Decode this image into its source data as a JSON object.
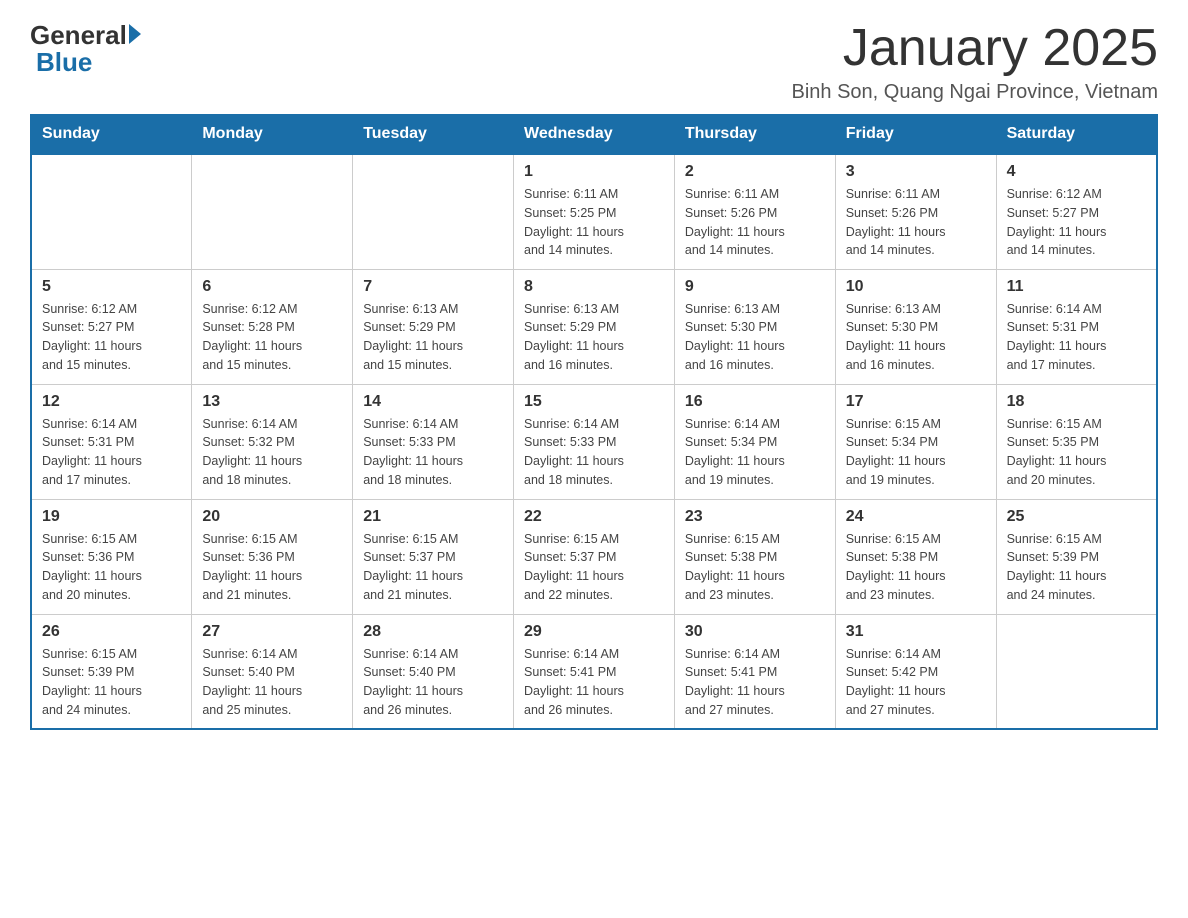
{
  "header": {
    "logo_general": "General",
    "logo_blue": "Blue",
    "month_title": "January 2025",
    "location": "Binh Son, Quang Ngai Province, Vietnam"
  },
  "days_of_week": [
    "Sunday",
    "Monday",
    "Tuesday",
    "Wednesday",
    "Thursday",
    "Friday",
    "Saturday"
  ],
  "weeks": [
    [
      {
        "day": "",
        "info": ""
      },
      {
        "day": "",
        "info": ""
      },
      {
        "day": "",
        "info": ""
      },
      {
        "day": "1",
        "info": "Sunrise: 6:11 AM\nSunset: 5:25 PM\nDaylight: 11 hours\nand 14 minutes."
      },
      {
        "day": "2",
        "info": "Sunrise: 6:11 AM\nSunset: 5:26 PM\nDaylight: 11 hours\nand 14 minutes."
      },
      {
        "day": "3",
        "info": "Sunrise: 6:11 AM\nSunset: 5:26 PM\nDaylight: 11 hours\nand 14 minutes."
      },
      {
        "day": "4",
        "info": "Sunrise: 6:12 AM\nSunset: 5:27 PM\nDaylight: 11 hours\nand 14 minutes."
      }
    ],
    [
      {
        "day": "5",
        "info": "Sunrise: 6:12 AM\nSunset: 5:27 PM\nDaylight: 11 hours\nand 15 minutes."
      },
      {
        "day": "6",
        "info": "Sunrise: 6:12 AM\nSunset: 5:28 PM\nDaylight: 11 hours\nand 15 minutes."
      },
      {
        "day": "7",
        "info": "Sunrise: 6:13 AM\nSunset: 5:29 PM\nDaylight: 11 hours\nand 15 minutes."
      },
      {
        "day": "8",
        "info": "Sunrise: 6:13 AM\nSunset: 5:29 PM\nDaylight: 11 hours\nand 16 minutes."
      },
      {
        "day": "9",
        "info": "Sunrise: 6:13 AM\nSunset: 5:30 PM\nDaylight: 11 hours\nand 16 minutes."
      },
      {
        "day": "10",
        "info": "Sunrise: 6:13 AM\nSunset: 5:30 PM\nDaylight: 11 hours\nand 16 minutes."
      },
      {
        "day": "11",
        "info": "Sunrise: 6:14 AM\nSunset: 5:31 PM\nDaylight: 11 hours\nand 17 minutes."
      }
    ],
    [
      {
        "day": "12",
        "info": "Sunrise: 6:14 AM\nSunset: 5:31 PM\nDaylight: 11 hours\nand 17 minutes."
      },
      {
        "day": "13",
        "info": "Sunrise: 6:14 AM\nSunset: 5:32 PM\nDaylight: 11 hours\nand 18 minutes."
      },
      {
        "day": "14",
        "info": "Sunrise: 6:14 AM\nSunset: 5:33 PM\nDaylight: 11 hours\nand 18 minutes."
      },
      {
        "day": "15",
        "info": "Sunrise: 6:14 AM\nSunset: 5:33 PM\nDaylight: 11 hours\nand 18 minutes."
      },
      {
        "day": "16",
        "info": "Sunrise: 6:14 AM\nSunset: 5:34 PM\nDaylight: 11 hours\nand 19 minutes."
      },
      {
        "day": "17",
        "info": "Sunrise: 6:15 AM\nSunset: 5:34 PM\nDaylight: 11 hours\nand 19 minutes."
      },
      {
        "day": "18",
        "info": "Sunrise: 6:15 AM\nSunset: 5:35 PM\nDaylight: 11 hours\nand 20 minutes."
      }
    ],
    [
      {
        "day": "19",
        "info": "Sunrise: 6:15 AM\nSunset: 5:36 PM\nDaylight: 11 hours\nand 20 minutes."
      },
      {
        "day": "20",
        "info": "Sunrise: 6:15 AM\nSunset: 5:36 PM\nDaylight: 11 hours\nand 21 minutes."
      },
      {
        "day": "21",
        "info": "Sunrise: 6:15 AM\nSunset: 5:37 PM\nDaylight: 11 hours\nand 21 minutes."
      },
      {
        "day": "22",
        "info": "Sunrise: 6:15 AM\nSunset: 5:37 PM\nDaylight: 11 hours\nand 22 minutes."
      },
      {
        "day": "23",
        "info": "Sunrise: 6:15 AM\nSunset: 5:38 PM\nDaylight: 11 hours\nand 23 minutes."
      },
      {
        "day": "24",
        "info": "Sunrise: 6:15 AM\nSunset: 5:38 PM\nDaylight: 11 hours\nand 23 minutes."
      },
      {
        "day": "25",
        "info": "Sunrise: 6:15 AM\nSunset: 5:39 PM\nDaylight: 11 hours\nand 24 minutes."
      }
    ],
    [
      {
        "day": "26",
        "info": "Sunrise: 6:15 AM\nSunset: 5:39 PM\nDaylight: 11 hours\nand 24 minutes."
      },
      {
        "day": "27",
        "info": "Sunrise: 6:14 AM\nSunset: 5:40 PM\nDaylight: 11 hours\nand 25 minutes."
      },
      {
        "day": "28",
        "info": "Sunrise: 6:14 AM\nSunset: 5:40 PM\nDaylight: 11 hours\nand 26 minutes."
      },
      {
        "day": "29",
        "info": "Sunrise: 6:14 AM\nSunset: 5:41 PM\nDaylight: 11 hours\nand 26 minutes."
      },
      {
        "day": "30",
        "info": "Sunrise: 6:14 AM\nSunset: 5:41 PM\nDaylight: 11 hours\nand 27 minutes."
      },
      {
        "day": "31",
        "info": "Sunrise: 6:14 AM\nSunset: 5:42 PM\nDaylight: 11 hours\nand 27 minutes."
      },
      {
        "day": "",
        "info": ""
      }
    ]
  ]
}
